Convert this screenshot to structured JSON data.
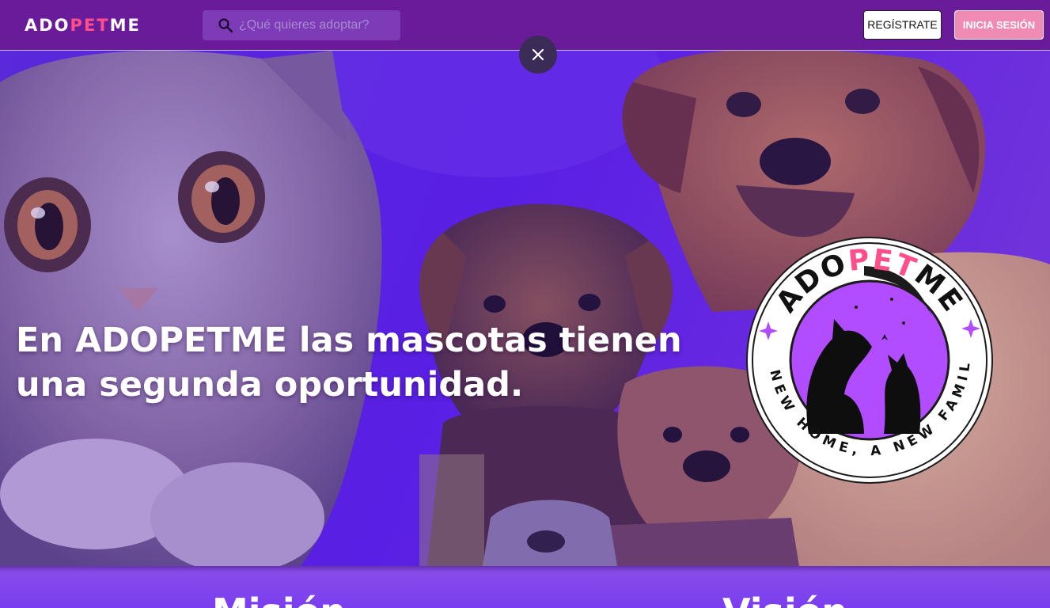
{
  "nav": {
    "logo": {
      "part1": "ADO",
      "part2": "PET",
      "part3": "ME"
    },
    "search": {
      "placeholder": "¿Qué quieres adoptar?",
      "icon": "search-icon"
    },
    "register_label": "REGÍSTRATE",
    "login_label": "INICIA SESIÓN"
  },
  "hero": {
    "close_icon": "close-icon",
    "headline": "En ADOPETME las mascotas tienen una segunda oportunidad.",
    "badge": {
      "top_text_1": "ADO",
      "top_text_2": "PET",
      "top_text_3": "ME",
      "bottom_text": "A NEW HOME, A NEW FAMILY"
    }
  },
  "sections": {
    "mision_title": "Misión",
    "vision_title": "Visión"
  },
  "colors": {
    "navbar": "#6a1b9a",
    "accent_pink": "#ff4f8b",
    "login_button": "#f08bb3",
    "hero_purple": "#5a1fe6",
    "section_purple": "#8a4fe8"
  }
}
